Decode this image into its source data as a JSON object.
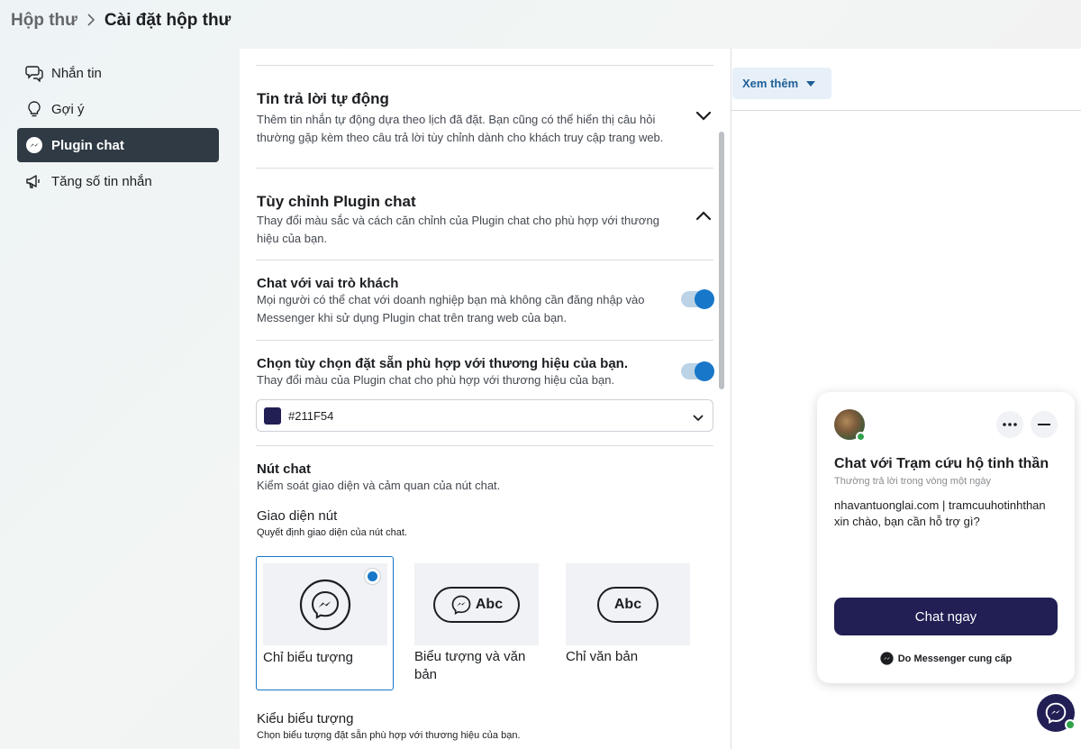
{
  "breadcrumb": {
    "root": "Hộp thư",
    "separator": ">",
    "current": "Cài đặt hộp thư"
  },
  "nav": {
    "items": [
      {
        "label": "Nhắn tin",
        "icon": "chat-bubbles-icon"
      },
      {
        "label": "Gợi ý",
        "icon": "lightbulb-icon"
      },
      {
        "label": "Plugin chat",
        "icon": "messenger-icon",
        "active": true
      },
      {
        "label": "Tăng số tin nhắn",
        "icon": "megaphone-icon"
      }
    ]
  },
  "sections": {
    "auto_reply": {
      "title": "Tin trả lời tự động",
      "desc_line1": "Thêm tin nhắn tự động dựa theo lịch đã đặt. Bạn cũng có thể hiển thị câu hỏi",
      "desc_line2": "thường gặp kèm theo câu trả lời tùy chỉnh dành cho khách truy cập trang web."
    },
    "customize": {
      "title": "Tùy chỉnh Plugin chat",
      "desc_line1": "Thay đổi màu sắc và cách căn chỉnh của Plugin chat cho phù hợp với thương",
      "desc_line2": "hiệu của bạn."
    },
    "guest_chat": {
      "title": "Chat với vai trò khách",
      "desc_line1": "Mọi người có thể chat với doanh nghiệp bạn mà không cần đăng nhập vào",
      "desc_line2": "Messenger khi sử dụng Plugin chat trên trang web của bạn.",
      "enabled": true
    },
    "preset": {
      "title": "Chọn tùy chọn đặt sẵn phù hợp với thương hiệu của bạn.",
      "desc": "Thay đổi màu của Plugin chat cho phù hợp với thương hiệu của bạn.",
      "enabled": true,
      "color_value": "#211F54",
      "swatch_color": "#211F54"
    },
    "chat_button": {
      "title": "Nút chat",
      "desc": "Kiểm soát giao diện và cảm quan của nút chat.",
      "appearance_title": "Giao diện nút",
      "appearance_desc": "Quyết định giao diện của nút chat.",
      "options": [
        {
          "label": "Chỉ biểu tượng",
          "selected": true
        },
        {
          "label_line1": "Biểu tượng và văn",
          "label_line2": "bản",
          "pill_text": "Abc"
        },
        {
          "label": "Chỉ văn bản",
          "pill_text": "Abc"
        }
      ],
      "icon_style_title": "Kiểu biểu tượng",
      "icon_style_desc": "Chọn biểu tượng đặt sẵn phù hợp với thương hiệu của bạn."
    }
  },
  "right": {
    "see_more_label": "Xem thêm"
  },
  "widget": {
    "title": "Chat với Trạm cứu hộ tinh thần",
    "subtitle": "Thường trả lời trong vòng một ngày",
    "message_line1": "nhavantuonglai.com | tramcuuhotinhthan",
    "message_line2": "xin chào, bạn cần hỗ trợ gì?",
    "cta_label": "Chat ngay",
    "footer_label": "Do Messenger cung cấp",
    "brand_color": "#211F54"
  },
  "colors": {
    "accent": "#1877C9",
    "active_nav": "#2F3A44"
  }
}
